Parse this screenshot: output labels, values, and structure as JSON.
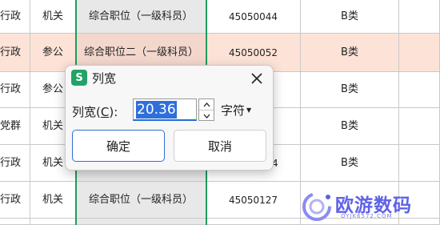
{
  "sheet": {
    "rows": [
      {
        "a": "行政",
        "b": "机关",
        "c": "综合职位（一级科员）",
        "d": "45050044",
        "e": "B类",
        "highlight": false
      },
      {
        "a": "行政",
        "b": "参公",
        "c": "综合职位二（一级科员）",
        "d": "45050052",
        "e": "B类",
        "highlight": true
      },
      {
        "a": "行政",
        "b": "参公",
        "c": "",
        "d": "",
        "e": "B类",
        "highlight": false
      },
      {
        "a": "党群",
        "b": "机关",
        "c": "",
        "d": "",
        "e": "B类",
        "highlight": false
      },
      {
        "a": "行政",
        "b": "机关",
        "c": "",
        "d": "4",
        "e": "B类",
        "highlight": false
      },
      {
        "a": "行政",
        "b": "机关",
        "c": "综合职位（一级科员）",
        "d": "45050127",
        "e": "",
        "highlight": false
      },
      {
        "a": "",
        "b": "",
        "c": "",
        "d": "",
        "e": "",
        "highlight": false
      }
    ]
  },
  "dialog": {
    "app_icon": "S",
    "title": "列宽",
    "close_icon": "close-icon",
    "field_label": "列宽(",
    "field_label_hotkey": "C",
    "field_label_end": "):",
    "value": "20.36",
    "unit": "字符",
    "ok_label": "确定",
    "cancel_label": "取消",
    "accent_color": "#2f6fd3"
  },
  "watermark": {
    "text": "欧游数码",
    "sub": "OYJK6572.COM"
  }
}
